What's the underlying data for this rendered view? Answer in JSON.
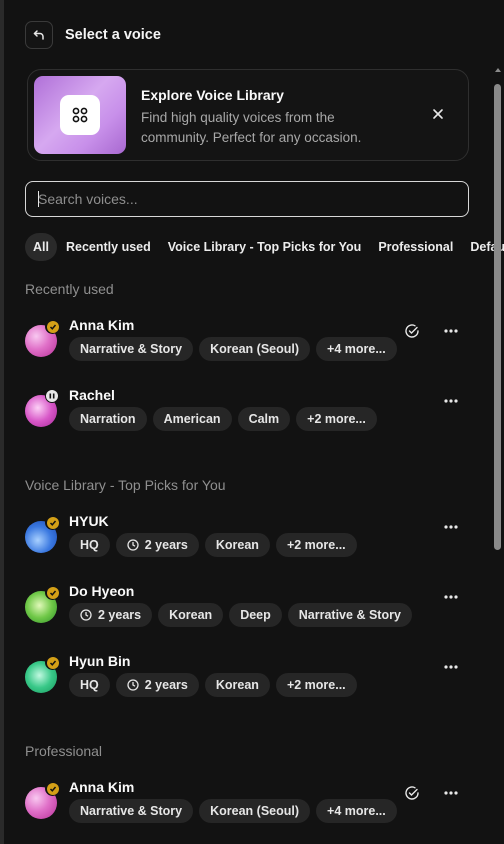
{
  "header": {
    "title": "Select a voice"
  },
  "promo": {
    "title": "Explore Voice Library",
    "description": "Find high quality voices from the community. Perfect for any occasion."
  },
  "search": {
    "placeholder": "Search voices..."
  },
  "filters": [
    "All",
    "Recently used",
    "Voice Library - Top Picks for You",
    "Professional",
    "Default"
  ],
  "sections": {
    "recently_used": "Recently used",
    "top_picks": "Voice Library - Top Picks for You",
    "professional": "Professional"
  },
  "voices": [
    {
      "name": "Anna Kim",
      "tags": [
        "Narrative & Story",
        "Korean (Seoul)",
        "+4 more..."
      ],
      "selected": true,
      "badge": "verified",
      "avatar_colors": [
        "#e070c8",
        "#f4b0e8",
        "#c040a8"
      ]
    },
    {
      "name": "Rachel",
      "tags": [
        "Narration",
        "American",
        "Calm",
        "+2 more..."
      ],
      "selected": false,
      "badge": "pause",
      "avatar_colors": [
        "#d050c0",
        "#f8c0f0",
        "#b030a0"
      ]
    },
    {
      "name": "HYUK",
      "tags": [
        "HQ",
        "2 years",
        "Korean",
        "+2 more..."
      ],
      "selected": false,
      "badge": "verified",
      "avatar_colors": [
        "#3a78e0",
        "#8ec0ff",
        "#1a50c0"
      ]
    },
    {
      "name": "Do Hyeon",
      "tags": [
        "2 years",
        "Korean",
        "Deep",
        "Narrative & Story"
      ],
      "selected": false,
      "badge": "verified",
      "avatar_colors": [
        "#60c040",
        "#c8f0a0",
        "#30a030"
      ]
    },
    {
      "name": "Hyun Bin",
      "tags": [
        "HQ",
        "2 years",
        "Korean",
        "+2 more..."
      ],
      "selected": false,
      "badge": "verified",
      "avatar_colors": [
        "#30c080",
        "#a0f0c8",
        "#18a060"
      ]
    },
    {
      "name": "Anna Kim",
      "tags": [
        "Narrative & Story",
        "Korean (Seoul)",
        "+4 more..."
      ],
      "selected": true,
      "badge": "verified",
      "avatar_colors": [
        "#e070c8",
        "#f4b0e8",
        "#c040a8"
      ]
    }
  ],
  "colors": {
    "accent_gold": "#d4a017",
    "background": "#121212",
    "tag_bg": "#262626"
  }
}
